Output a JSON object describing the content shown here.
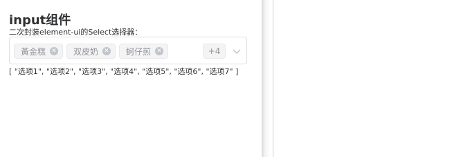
{
  "title": "input组件",
  "subtitle": "二次封装element-ui的Select选择器：",
  "select": {
    "tags": [
      {
        "label": "黃金糕",
        "close_icon": "close-circle-icon"
      },
      {
        "label": "双皮奶",
        "close_icon": "close-circle-icon"
      },
      {
        "label": "蚵仔煎",
        "close_icon": "close-circle-icon"
      }
    ],
    "collapsed_count": "+4",
    "arrow_icon": "chevron-down-icon"
  },
  "value_display": "[ \"选项1\", \"选项2\", \"选项3\", \"选项4\", \"选项5\", \"选项6\", \"选项7\" ]",
  "colors": {
    "text": "#303133",
    "tag_bg": "#f4f4f5",
    "tag_text": "#909399",
    "border": "#dcdfe6"
  }
}
